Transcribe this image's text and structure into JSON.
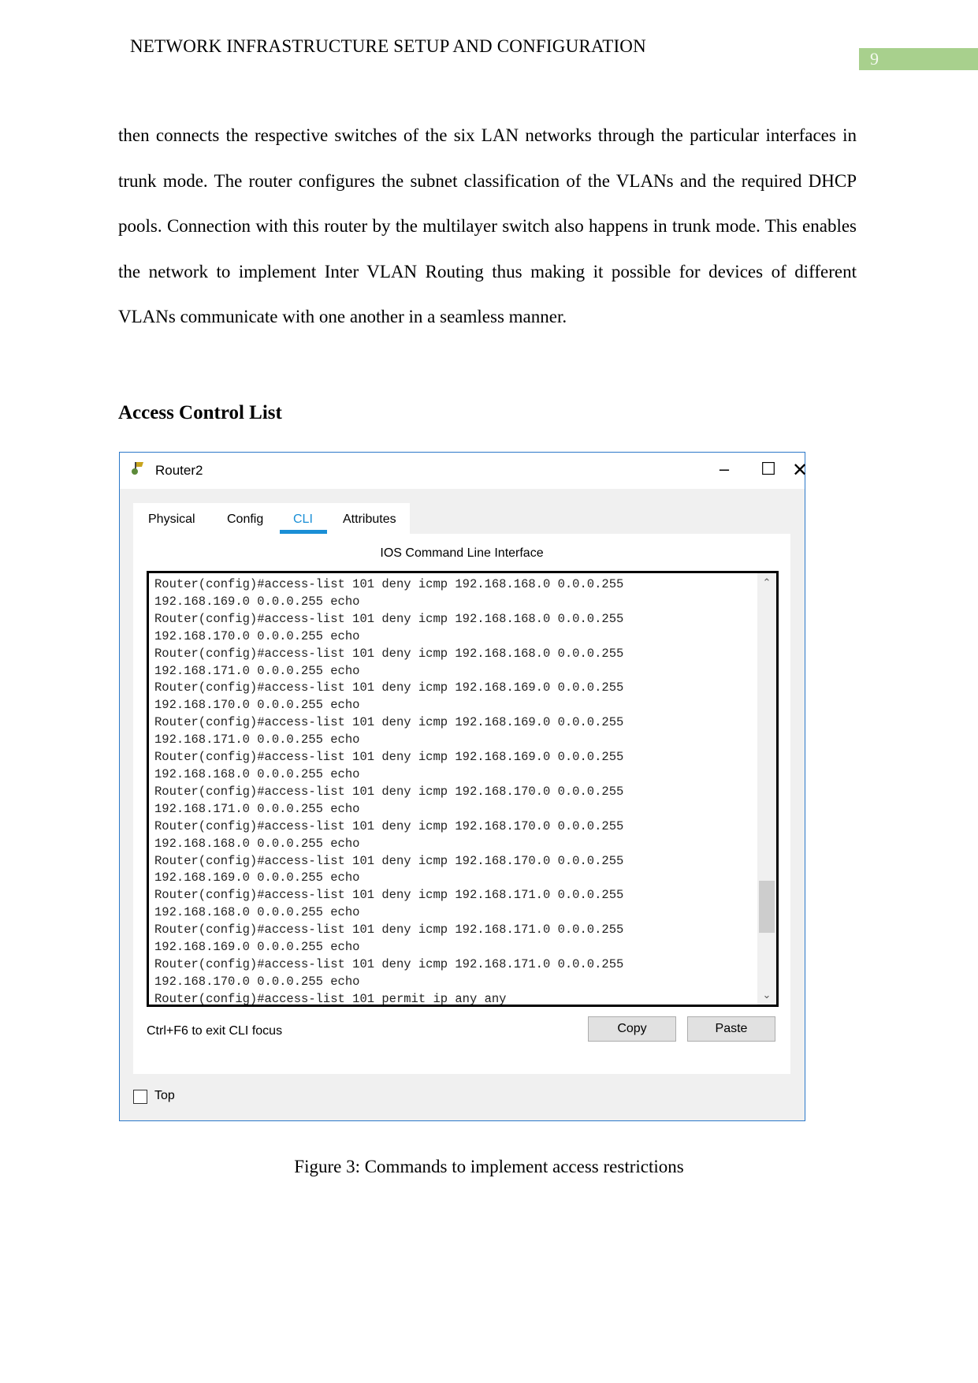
{
  "header": {
    "title": "NETWORK INFRASTRUCTURE SETUP AND CONFIGURATION",
    "page_number": "9"
  },
  "body_text": "then connects the respective switches of the six LAN networks through the particular interfaces in trunk mode. The router configures the subnet classification of the VLANs and the required DHCP pools. Connection with this router by the multilayer switch also happens in trunk mode. This enables the network to implement Inter VLAN Routing thus making it possible for devices of different VLANs communicate with one another in a seamless manner.",
  "section_heading": "Access Control List",
  "window": {
    "title": "Router2",
    "icon": "router-icon",
    "tabs": [
      {
        "label": "Physical"
      },
      {
        "label": "Config"
      },
      {
        "label": "CLI",
        "active": true
      },
      {
        "label": "Attributes"
      }
    ],
    "cli_caption": "IOS Command Line Interface",
    "cli_lines": "Router(config)#access-list 101 deny icmp 192.168.168.0 0.0.0.255\n192.168.169.0 0.0.0.255 echo\nRouter(config)#access-list 101 deny icmp 192.168.168.0 0.0.0.255\n192.168.170.0 0.0.0.255 echo\nRouter(config)#access-list 101 deny icmp 192.168.168.0 0.0.0.255\n192.168.171.0 0.0.0.255 echo\nRouter(config)#access-list 101 deny icmp 192.168.169.0 0.0.0.255\n192.168.170.0 0.0.0.255 echo\nRouter(config)#access-list 101 deny icmp 192.168.169.0 0.0.0.255\n192.168.171.0 0.0.0.255 echo\nRouter(config)#access-list 101 deny icmp 192.168.169.0 0.0.0.255\n192.168.168.0 0.0.0.255 echo\nRouter(config)#access-list 101 deny icmp 192.168.170.0 0.0.0.255\n192.168.171.0 0.0.0.255 echo\nRouter(config)#access-list 101 deny icmp 192.168.170.0 0.0.0.255\n192.168.168.0 0.0.0.255 echo\nRouter(config)#access-list 101 deny icmp 192.168.170.0 0.0.0.255\n192.168.169.0 0.0.0.255 echo\nRouter(config)#access-list 101 deny icmp 192.168.171.0 0.0.0.255\n192.168.168.0 0.0.0.255 echo\nRouter(config)#access-list 101 deny icmp 192.168.171.0 0.0.0.255\n192.168.169.0 0.0.0.255 echo\nRouter(config)#access-list 101 deny icmp 192.168.171.0 0.0.0.255\n192.168.170.0 0.0.0.255 echo\nRouter(config)#access-list 101 permit ip any any",
    "hint": "Ctrl+F6 to exit CLI focus",
    "copy_label": "Copy",
    "paste_label": "Paste",
    "top_label": "Top",
    "top_checked": false,
    "accent": "#1a8fd6"
  },
  "caption": "Figure 3: Commands to implement access restrictions"
}
